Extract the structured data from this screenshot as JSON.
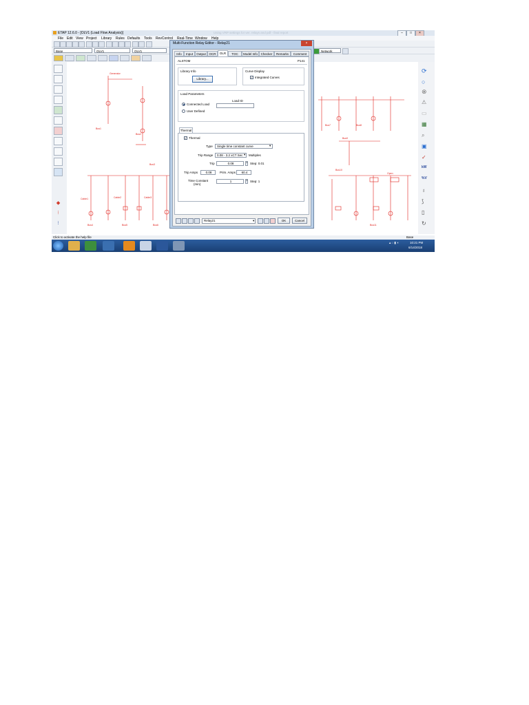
{
  "window": {
    "title": "ETAP 12.6.0 - [OLV1 (Load Flow Analysis)]",
    "faded_title_text": "Using VRP settings for ver. relays and pdf - final report",
    "controls": [
      "–",
      "□",
      "×"
    ]
  },
  "menubar": {
    "items": [
      "File",
      "Edit",
      "View",
      "Project",
      "Library",
      "Rules",
      "Defaults",
      "Tools",
      "RevControl",
      "Real-Time",
      "Window",
      "Help"
    ]
  },
  "toolbar": {
    "mode_combo": "Base",
    "view_combo": "OLV1",
    "presentation_combo": "OLV1",
    "right_combo": "Network"
  },
  "dialog": {
    "title": "Multi-Function Relay Editor - Relay21",
    "close_label": "×",
    "tabs": [
      "Info",
      "Input",
      "Output",
      "OCR",
      "OLR",
      "TOC Info",
      "Model Info",
      "Checker",
      "Remarks",
      "Comment"
    ],
    "active_tab": "OLR",
    "manufacturer": "ALSTOM",
    "model": "P141",
    "library_info": {
      "title": "Library Info",
      "button": "Library..."
    },
    "curve_display": {
      "title": "Curve Display",
      "checkbox": "Integrated Curves",
      "checked": true
    },
    "load_parameters": {
      "title": "Load Parameters",
      "load_id_label": "Load ID",
      "load_id_value": "",
      "options": [
        "Connected Load",
        "User Defined"
      ],
      "selected": "Connected Load"
    },
    "thermal": {
      "tab_label": "Thermal",
      "checkbox": "Thermal",
      "checked": true,
      "type_label": "Type",
      "type_value": "Single time constant curve",
      "trip_range_label": "Trip Range",
      "trip_range_value": "0.08 - 3.2 xCT Sec",
      "trip_range_unit": "Multiples",
      "trip_label": "Trip",
      "trip_value": "0.08",
      "trip_step": "Step: 0.01",
      "trip_amps_label": "Trip Amps",
      "trip_amps_value": "0.08",
      "prim_amps_label": "Prim. Amps",
      "prim_amps_value": "60.4",
      "time_constant_label": "Time Constant",
      "time_constant_unit": "(min)",
      "time_constant_value": "1",
      "time_constant_step": "Step: 1"
    },
    "footer": {
      "relay_combo": "Relay21",
      "ok": "OK",
      "cancel": "Cancel"
    }
  },
  "diagram": {
    "labels": [
      "Generator",
      "Cable1",
      "Cable2",
      "Cable3",
      "Bus1",
      "Bus2",
      "Bus3",
      "Bus4",
      "Bus5",
      "Bus6",
      "Bus7",
      "Bus8",
      "Bus9",
      "Bus10",
      "Bus11",
      "Open"
    ],
    "line_color": "#e0201b"
  },
  "status": {
    "left": "Click to activate the help file",
    "right": "Base"
  },
  "taskbar": {
    "time": "10:21 PM",
    "date": "6/14/2018"
  },
  "colors": {
    "diagram_red": "#e0201b",
    "dialog_frame": "#b9cfe8",
    "taskbar": "#1a3f73"
  }
}
